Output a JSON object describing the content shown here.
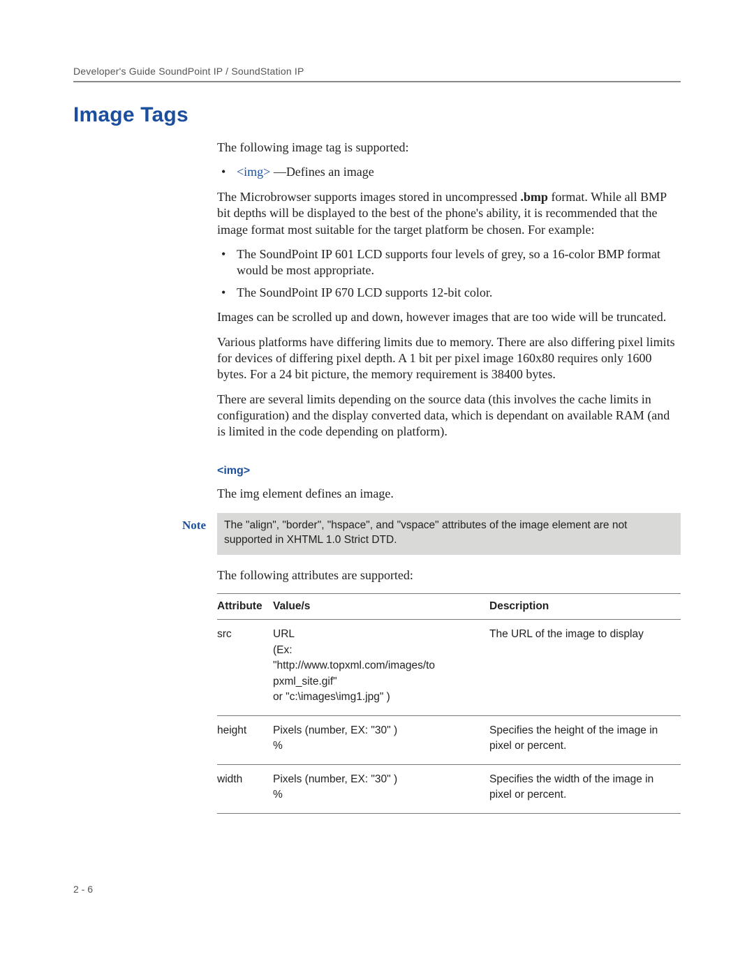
{
  "header": "Developer's Guide SoundPoint IP / SoundStation IP",
  "section_title": "Image Tags",
  "p_intro": "The following image tag is supported:",
  "bullet1_link": "<img>",
  "bullet1_rest": "—Defines an image",
  "p2_a": "The Microbrowser supports images stored in uncompressed ",
  "p2_b": ".bmp",
  "p2_c": " format. While all BMP bit depths will be displayed to the best of the phone's ability, it is recommended that the image format most suitable for the target platform be chosen. For example:",
  "bullet_a": "The SoundPoint IP 601 LCD supports four levels of grey, so a 16-color BMP format would be most appropriate.",
  "bullet_b": "The SoundPoint IP 670 LCD supports 12-bit color.",
  "p3": "Images can be scrolled up and down, however images that are too wide will be truncated.",
  "p4": "Various platforms have differing limits due to memory. There are also differing pixel limits for devices of differing pixel depth. A 1 bit per pixel image 160x80 requires only 1600 bytes. For a 24 bit picture, the memory requirement is 38400 bytes.",
  "p5": "There are several limits depending on the source data (this involves the cache limits in configuration) and the display converted data, which is dependant on available RAM (and is limited in the code depending on platform).",
  "sub_heading": "<img>",
  "p_img_def": "The img element defines an image.",
  "note_label": "Note",
  "note_text": "The \"align\", \"border\", \"hspace\", and \"vspace\" attributes of the image element are not supported in XHTML 1.0 Strict DTD.",
  "p_attr_intro": "The following attributes are supported:",
  "table": {
    "headers": {
      "c1": "Attribute",
      "c2": "Value/s",
      "c3": "Description"
    },
    "rows": [
      {
        "attr": "src",
        "val_l1": "URL",
        "val_l2": "(Ex:",
        "val_l3": "\"http://www.topxml.com/images/to pxml_site.gif\"",
        "val_l4": "or \"c:\\images\\img1.jpg\" )",
        "desc": "The URL of the image to display"
      },
      {
        "attr": "height",
        "val_l1": "Pixels (number, EX: \"30\" )",
        "val_l2": "%",
        "desc": "Specifies the height of the image in pixel or percent."
      },
      {
        "attr": "width",
        "val_l1": "Pixels (number, EX: \"30\" )",
        "val_l2": "%",
        "desc": "Specifies the width of the image in pixel or percent."
      }
    ]
  },
  "footer": "2 - 6"
}
